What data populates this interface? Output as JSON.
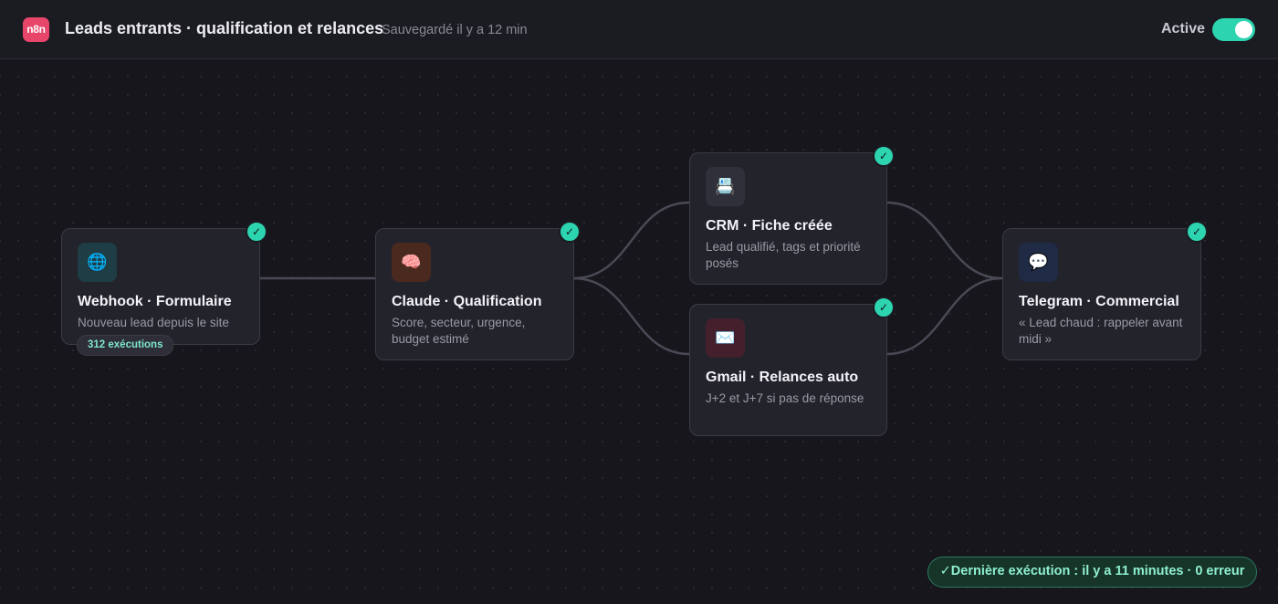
{
  "topbar": {
    "logo": "n8n",
    "workflow_title": "Leads entrants · qualification et relances",
    "saved_status": "Sauvegardé il y a 12 min",
    "active_label": "Active",
    "active": true
  },
  "nodes": [
    {
      "id": "webhook",
      "icon": "globe-icon",
      "icon_glyph": "🌐",
      "icon_bg": "#1e3d44",
      "title": "Webhook · Formulaire",
      "description": "Nouveau lead depuis le site",
      "badge": "312 exécutions",
      "status": "success"
    },
    {
      "id": "claude",
      "icon": "brain-icon",
      "icon_glyph": "🧠",
      "icon_bg": "#4a2a1f",
      "title": "Claude · Qualification",
      "description": "Score, secteur, urgence, budget estimé",
      "status": "success"
    },
    {
      "id": "crm",
      "icon": "card-file-icon",
      "icon_glyph": "📇",
      "icon_bg": "#30303a",
      "title": "CRM · Fiche créée",
      "description": "Lead qualifié, tags et priorité posés",
      "status": "success"
    },
    {
      "id": "gmail",
      "icon": "envelope-icon",
      "icon_glyph": "✉️",
      "icon_bg": "#44202c",
      "title": "Gmail · Relances auto",
      "description": "J+2 et J+7 si pas de réponse",
      "status": "success"
    },
    {
      "id": "telegram",
      "icon": "speech-bubble-icon",
      "icon_glyph": "💬",
      "icon_bg": "#1f2a44",
      "title": "Telegram · Commercial",
      "description": "« Lead chaud : rappeler avant midi »",
      "status": "success"
    }
  ],
  "status_footer": "✓Dernière exécution : il y a 11 minutes · 0 erreur",
  "colors": {
    "accent": "#2dd4b0",
    "brand": "#e8456b",
    "canvas": "#16161c",
    "node_bg": "#23232c",
    "connection": "#4a4a56"
  }
}
